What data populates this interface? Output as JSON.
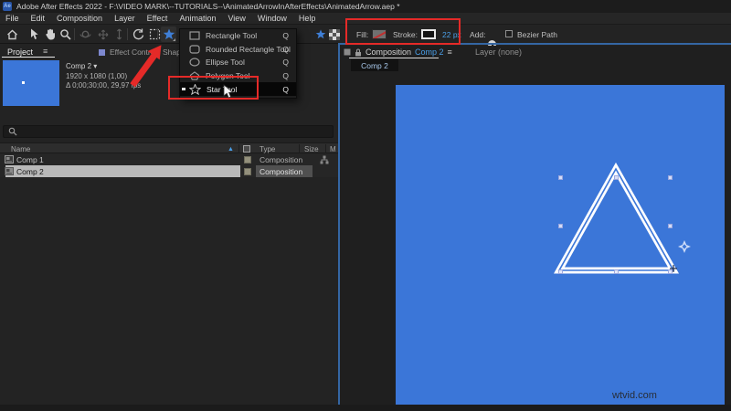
{
  "title_bar": {
    "app_icon_label": "Ae",
    "title": "Adobe After Effects 2022 - F:\\VIDEO MARK\\--TUTORIALS--\\AnimatedArrowInAfterEffects\\AnimatedArrow.aep *"
  },
  "menu_bar": {
    "items": [
      "File",
      "Edit",
      "Composition",
      "Layer",
      "Effect",
      "Animation",
      "View",
      "Window",
      "Help"
    ]
  },
  "toolbar": {
    "fill_label": "Fill:",
    "stroke_label": "Stroke:",
    "stroke_width": "22 px",
    "add_label": "Add:",
    "bezier_path_label": "Bezier Path"
  },
  "tool_menu": {
    "items": [
      {
        "label": "Rectangle Tool",
        "shortcut": "Q"
      },
      {
        "label": "Rounded Rectangle Tool",
        "shortcut": "Q"
      },
      {
        "label": "Ellipse Tool",
        "shortcut": "Q"
      },
      {
        "label": "Polygon Tool",
        "shortcut": "Q"
      },
      {
        "label": "Star Tool",
        "shortcut": "Q"
      }
    ],
    "selected_item": "Star Tool"
  },
  "project_panel": {
    "tab_project": "Project",
    "tab_menu_icon": "≡",
    "tab_effect_controls": "Effect Controls Shape Layer 1",
    "comp_name": "Comp 2 ▾",
    "comp_resolution": "1920 x 1080 (1,00)",
    "comp_timing": "Δ 0;00;30;00, 29,97 fps",
    "columns": {
      "name": "Name",
      "sort_icon": "▲",
      "type": "Type",
      "size": "Size",
      "media": "M"
    },
    "rows": [
      {
        "name": "Comp 1",
        "type": "Composition"
      },
      {
        "name": "Comp 2",
        "type": "Composition"
      }
    ]
  },
  "composition_panel": {
    "panel_title": "Composition",
    "active_comp": "Comp 2",
    "panel_menu_icon": "≡",
    "layer_panel_label": "Layer (none)",
    "viewer_tab": "Comp 2"
  },
  "canvas": {
    "watermark": "wtvid.com"
  },
  "colors": {
    "canvas_blue": "#3b76d8",
    "accent_blue": "#4a9fe8",
    "annotation_red": "#e52a28",
    "selected_row_bg": "#b9b9b9"
  }
}
